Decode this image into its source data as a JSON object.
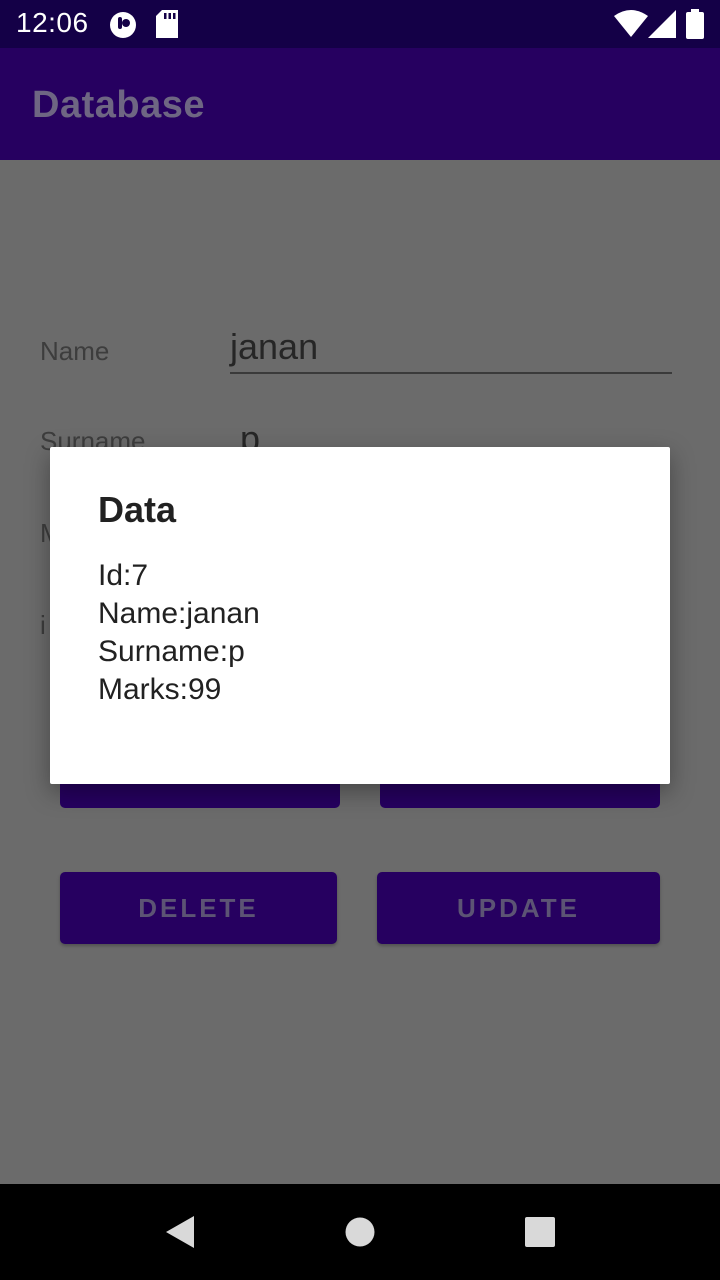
{
  "status_bar": {
    "time": "12:06",
    "left_icons": [
      "privacy-icon",
      "sd-card-icon"
    ],
    "right_icons": [
      "wifi-icon",
      "signal-icon",
      "battery-icon"
    ]
  },
  "app_bar": {
    "title": "Database"
  },
  "form": {
    "name_label": "Name",
    "name_value": "janan",
    "surname_label": "Surname",
    "surname_value": "p",
    "marks_label": "M",
    "id_label": "i"
  },
  "buttons": {
    "delete_label": "DELETE",
    "update_label": "UPDATE"
  },
  "dialog": {
    "title": "Data",
    "lines": [
      "Id:7",
      "Name:janan",
      "Surname:p",
      "Marks:99"
    ]
  },
  "nav_bar": {
    "buttons": [
      "back-icon",
      "home-icon",
      "recents-icon"
    ]
  },
  "colors": {
    "status_bar": "#140047",
    "app_bar": "#260060",
    "scrim": "#6b6b6b",
    "button": "#260060",
    "dialog": "#ffffff"
  }
}
